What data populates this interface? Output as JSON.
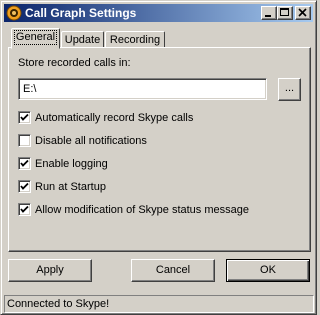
{
  "window": {
    "title": "Call Graph Settings"
  },
  "titlebar_buttons": {
    "minimize": "minimize-icon",
    "maximize": "maximize-icon",
    "close": "close-icon"
  },
  "tabs": [
    {
      "label": "General",
      "active": true
    },
    {
      "label": "Update",
      "active": false
    },
    {
      "label": "Recording",
      "active": false
    }
  ],
  "general": {
    "store_label": "Store recorded calls in:",
    "path_value": "E:\\",
    "browse_label": "...",
    "checkboxes": [
      {
        "label": "Automatically record Skype calls",
        "checked": true
      },
      {
        "label": "Disable all notifications",
        "checked": false
      },
      {
        "label": "Enable logging",
        "checked": true
      },
      {
        "label": "Run at Startup",
        "checked": true
      },
      {
        "label": "Allow modification of Skype status message",
        "checked": true
      }
    ]
  },
  "buttons": {
    "apply": "Apply",
    "cancel": "Cancel",
    "ok": "OK"
  },
  "status": {
    "text": "Connected to Skype!"
  },
  "colors": {
    "titlebar_start": "#0a246a",
    "titlebar_end": "#a6caf0",
    "face": "#d4d0c8"
  }
}
